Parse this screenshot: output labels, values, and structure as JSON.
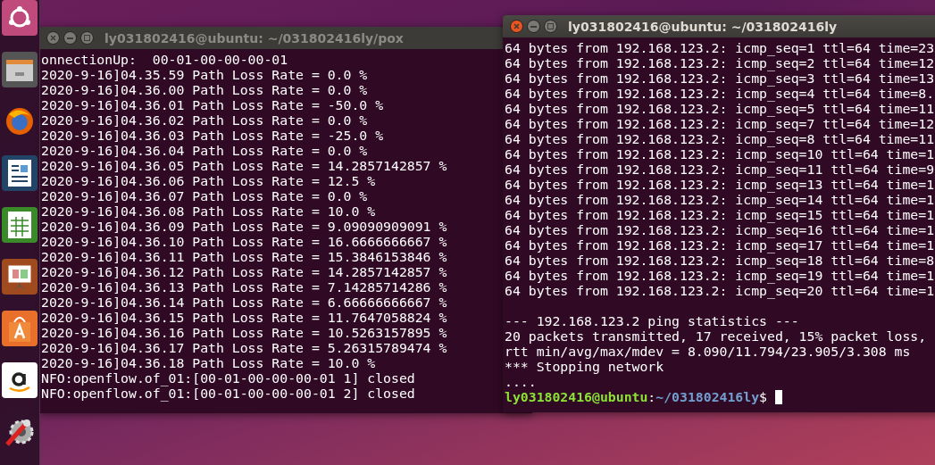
{
  "windows": [
    {
      "title": "ly031802416@ubuntu: ~/031802416ly/pox",
      "focused": false,
      "lines": [
        "onnectionUp:  00-01-00-00-00-01",
        "2020-9-16]04.35.59 Path Loss Rate = 0.0 %",
        "2020-9-16]04.36.00 Path Loss Rate = 0.0 %",
        "2020-9-16]04.36.01 Path Loss Rate = -50.0 %",
        "2020-9-16]04.36.02 Path Loss Rate = 0.0 %",
        "2020-9-16]04.36.03 Path Loss Rate = -25.0 %",
        "2020-9-16]04.36.04 Path Loss Rate = 0.0 %",
        "2020-9-16]04.36.05 Path Loss Rate = 14.2857142857 %",
        "2020-9-16]04.36.06 Path Loss Rate = 12.5 %",
        "2020-9-16]04.36.07 Path Loss Rate = 0.0 %",
        "2020-9-16]04.36.08 Path Loss Rate = 10.0 %",
        "2020-9-16]04.36.09 Path Loss Rate = 9.09090909091 %",
        "2020-9-16]04.36.10 Path Loss Rate = 16.6666666667 %",
        "2020-9-16]04.36.11 Path Loss Rate = 15.3846153846 %",
        "2020-9-16]04.36.12 Path Loss Rate = 14.2857142857 %",
        "2020-9-16]04.36.13 Path Loss Rate = 7.14285714286 %",
        "2020-9-16]04.36.14 Path Loss Rate = 6.66666666667 %",
        "2020-9-16]04.36.15 Path Loss Rate = 11.7647058824 %",
        "2020-9-16]04.36.16 Path Loss Rate = 10.5263157895 %",
        "2020-9-16]04.36.17 Path Loss Rate = 5.26315789474 %",
        "2020-9-16]04.36.18 Path Loss Rate = 10.0 %",
        "NFO:openflow.of_01:[00-01-00-00-00-01 1] closed",
        "NFO:openflow.of_01:[00-01-00-00-00-01 2] closed"
      ]
    },
    {
      "title": "ly031802416@ubuntu: ~/031802416ly",
      "focused": true,
      "lines": [
        "64 bytes from 192.168.123.2: icmp_seq=1 ttl=64 time=23",
        "64 bytes from 192.168.123.2: icmp_seq=2 ttl=64 time=12",
        "64 bytes from 192.168.123.2: icmp_seq=3 ttl=64 time=13",
        "64 bytes from 192.168.123.2: icmp_seq=4 ttl=64 time=8.",
        "64 bytes from 192.168.123.2: icmp_seq=5 ttl=64 time=11",
        "64 bytes from 192.168.123.2: icmp_seq=7 ttl=64 time=12",
        "64 bytes from 192.168.123.2: icmp_seq=8 ttl=64 time=11",
        "64 bytes from 192.168.123.2: icmp_seq=10 ttl=64 time=1",
        "64 bytes from 192.168.123.2: icmp_seq=11 ttl=64 time=9",
        "64 bytes from 192.168.123.2: icmp_seq=13 ttl=64 time=1",
        "64 bytes from 192.168.123.2: icmp_seq=14 ttl=64 time=1",
        "64 bytes from 192.168.123.2: icmp_seq=15 ttl=64 time=1",
        "64 bytes from 192.168.123.2: icmp_seq=16 ttl=64 time=1",
        "64 bytes from 192.168.123.2: icmp_seq=17 ttl=64 time=1",
        "64 bytes from 192.168.123.2: icmp_seq=18 ttl=64 time=8",
        "64 bytes from 192.168.123.2: icmp_seq=19 ttl=64 time=1",
        "64 bytes from 192.168.123.2: icmp_seq=20 ttl=64 time=1"
      ],
      "statistics": [
        "--- 192.168.123.2 ping statistics ---",
        "20 packets transmitted, 17 received, 15% packet loss,",
        "rtt min/avg/max/mdev = 8.090/11.794/23.905/3.308 ms",
        "*** Stopping network",
        "...."
      ],
      "prompt": {
        "user": "ly031802416@ubuntu",
        "separator": ":",
        "path": "~/031802416ly",
        "symbol": "$"
      }
    }
  ]
}
